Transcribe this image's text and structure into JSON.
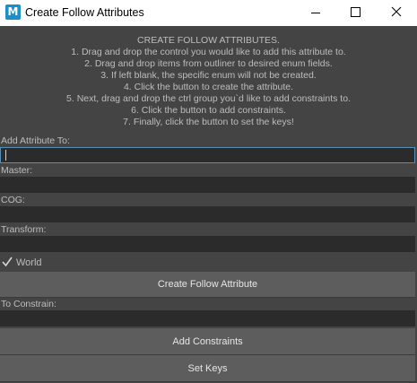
{
  "window": {
    "title": "Create Follow Attributes",
    "app_icon": "M"
  },
  "instructions": [
    "CREATE FOLLOW ATTRIBUTES.",
    "1. Drag and drop the control you would like to add this attribute to.",
    "2. Drag and drop items from outliner to desired enum fields.",
    "3. If left blank, the specific enum will not be created.",
    "4. Click the button to create the attribute.",
    "5. Next, drag and drop the ctrl group you`d like to add constraints to.",
    "6. Click the button to add constraints.",
    "7. Finally, click the button to set the keys!"
  ],
  "fields": {
    "add_attribute_to": {
      "label": "Add Attribute To:",
      "value": ""
    },
    "master": {
      "label": "Master:",
      "value": ""
    },
    "cog": {
      "label": "COG:",
      "value": ""
    },
    "transform": {
      "label": "Transform:",
      "value": ""
    },
    "to_constrain": {
      "label": "To Constrain:",
      "value": ""
    }
  },
  "world_checkbox": {
    "label": "World",
    "checked": true
  },
  "buttons": {
    "create_follow_attribute": "Create Follow Attribute",
    "add_constraints": "Add Constraints",
    "set_keys": "Set Keys"
  },
  "colors": {
    "background": "#444444",
    "field": "#2b2b2b",
    "button": "#5d5d5d",
    "focus_border": "#5a8fb5",
    "text": "#bdbdbd",
    "app_icon": "#1c8fc7"
  }
}
